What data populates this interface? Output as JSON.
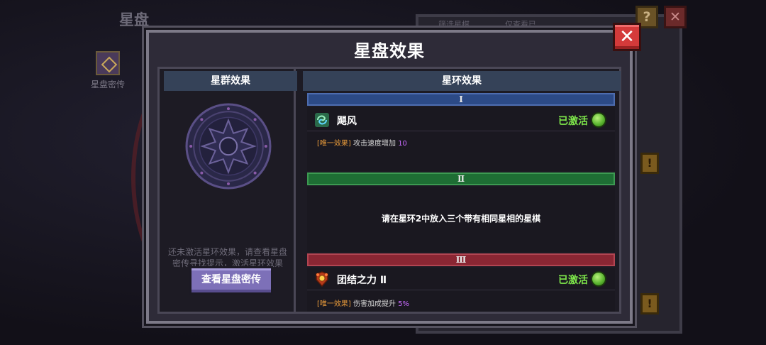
{
  "background": {
    "title": "星盘",
    "codex_label": "星盘密传",
    "help_glyph": "?",
    "close_glyph": "✕",
    "coin_glyph": "!",
    "tab_a": "筛选星棋",
    "tab_b": "仅查看已"
  },
  "modal": {
    "title": "星盘效果",
    "close_glyph": "✕",
    "left": {
      "header": "星群效果",
      "hint": "还未激活星环效果，请查看星盘密传寻找提示，激活星环效果",
      "button": "查看星盘密传"
    },
    "right": {
      "header": "星环效果",
      "rings": [
        {
          "numeral": "Ⅰ",
          "color": "#2c4a86",
          "effect": {
            "icon": "whirlwind-icon",
            "name": "飓风",
            "status": "已激活",
            "tag": "[唯一效果]",
            "desc": "攻击速度增加",
            "value": "10"
          }
        },
        {
          "numeral": "Ⅱ",
          "color": "#1e6e34",
          "message": "请在星环2中放入三个带有相同星相的星棋"
        },
        {
          "numeral": "Ⅲ",
          "color": "#8a2633",
          "effect": {
            "icon": "unity-emblem-icon",
            "name": "团结之力 Ⅱ",
            "status": "已激活",
            "tag": "[唯一效果]",
            "desc": "伤害加成提升",
            "value": "5%"
          }
        }
      ]
    }
  },
  "colors": {
    "active_green": "#7fe84b",
    "button_purple": "#7d70b8",
    "close_red": "#d43a3a"
  }
}
